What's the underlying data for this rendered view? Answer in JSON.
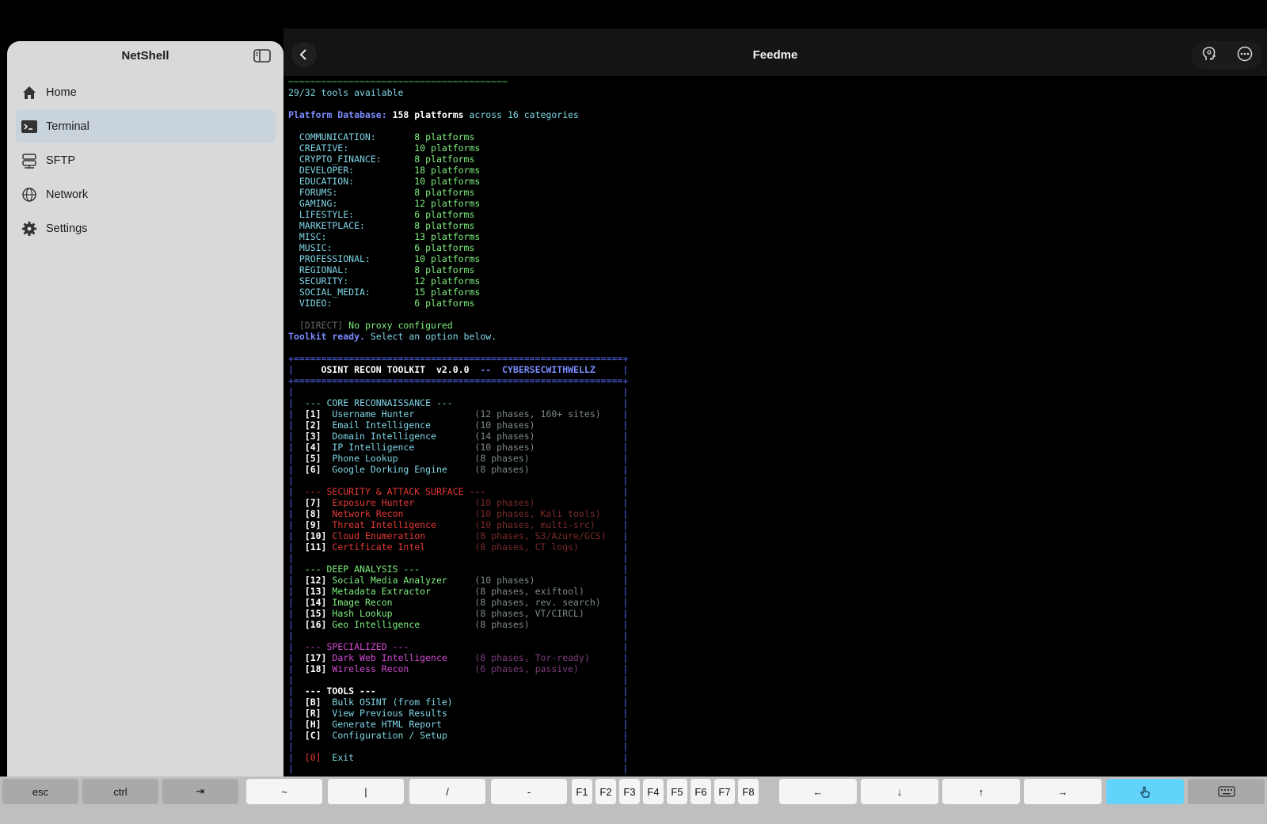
{
  "sidebar": {
    "title": "NetShell",
    "items": [
      {
        "label": "Home",
        "icon": "home-icon"
      },
      {
        "label": "Terminal",
        "icon": "terminal-icon",
        "active": true
      },
      {
        "label": "SFTP",
        "icon": "server-icon"
      },
      {
        "label": "Network",
        "icon": "globe-icon"
      },
      {
        "label": "Settings",
        "icon": "gear-icon"
      }
    ]
  },
  "header": {
    "title": "Feedme"
  },
  "terminal": {
    "tools_available": "29/32 tools available",
    "db_label": "Platform Database:",
    "db_count": "158 platforms",
    "db_mid": "across",
    "db_cat": "16 categories",
    "categories": [
      {
        "name": "COMMUNICATION:",
        "count": "8 platforms"
      },
      {
        "name": "CREATIVE:",
        "count": "10 platforms"
      },
      {
        "name": "CRYPTO_FINANCE:",
        "count": "8 platforms"
      },
      {
        "name": "DEVELOPER:",
        "count": "18 platforms"
      },
      {
        "name": "EDUCATION:",
        "count": "10 platforms"
      },
      {
        "name": "FORUMS:",
        "count": "8 platforms"
      },
      {
        "name": "GAMING:",
        "count": "12 platforms"
      },
      {
        "name": "LIFESTYLE:",
        "count": "6 platforms"
      },
      {
        "name": "MARKETPLACE:",
        "count": "8 platforms"
      },
      {
        "name": "MISC:",
        "count": "13 platforms"
      },
      {
        "name": "MUSIC:",
        "count": "6 platforms"
      },
      {
        "name": "PROFESSIONAL:",
        "count": "10 platforms"
      },
      {
        "name": "REGIONAL:",
        "count": "8 platforms"
      },
      {
        "name": "SECURITY:",
        "count": "12 platforms"
      },
      {
        "name": "SOCIAL_MEDIA:",
        "count": "15 platforms"
      },
      {
        "name": "VIDEO:",
        "count": "6 platforms"
      }
    ],
    "proxy_tag": "[DIRECT]",
    "proxy_msg": "No proxy configured",
    "ready_label": "Toolkit ready.",
    "ready_msg": "Select an option below.",
    "banner_title": "OSINT RECON TOOLKIT  v2.0.0",
    "banner_sep": "--",
    "banner_author": "CYBERSECWITHWELLZ",
    "sections": [
      {
        "title": "--- CORE RECONNAISSANCE ---",
        "style": "cyan",
        "items": [
          {
            "key": "[1]",
            "name": "Username Hunter",
            "desc": "(12 phases, 160+ sites)"
          },
          {
            "key": "[2]",
            "name": "Email Intelligence",
            "desc": "(10 phases)"
          },
          {
            "key": "[3]",
            "name": "Domain Intelligence",
            "desc": "(14 phases)"
          },
          {
            "key": "[4]",
            "name": "IP Intelligence",
            "desc": "(10 phases)"
          },
          {
            "key": "[5]",
            "name": "Phone Lookup",
            "desc": "(8 phases)"
          },
          {
            "key": "[6]",
            "name": "Google Dorking Engine",
            "desc": "(8 phases)"
          }
        ]
      },
      {
        "title": "--- SECURITY & ATTACK SURFACE ---",
        "style": "red",
        "items": [
          {
            "key": "[7]",
            "name": "Exposure Hunter",
            "desc": "(10 phases)"
          },
          {
            "key": "[8]",
            "name": "Network Recon",
            "desc": "(10 phases, Kali tools)"
          },
          {
            "key": "[9]",
            "name": "Threat Intelligence",
            "desc": "(10 phases, multi-src)"
          },
          {
            "key": "[10]",
            "name": "Cloud Enumeration",
            "desc": "(8 phases, S3/Azure/GCS)"
          },
          {
            "key": "[11]",
            "name": "Certificate Intel",
            "desc": "(8 phases, CT logs)"
          }
        ]
      },
      {
        "title": "--- DEEP ANALYSIS ---",
        "style": "green",
        "items": [
          {
            "key": "[12]",
            "name": "Social Media Analyzer",
            "desc": "(10 phases)"
          },
          {
            "key": "[13]",
            "name": "Metadata Extractor",
            "desc": "(8 phases, exiftool)"
          },
          {
            "key": "[14]",
            "name": "Image Recon",
            "desc": "(8 phases, rev. search)"
          },
          {
            "key": "[15]",
            "name": "Hash Lookup",
            "desc": "(8 phases, VT/CIRCL)"
          },
          {
            "key": "[16]",
            "name": "Geo Intelligence",
            "desc": "(8 phases)"
          }
        ]
      },
      {
        "title": "--- SPECIALIZED ---",
        "style": "magenta",
        "items": [
          {
            "key": "[17]",
            "name": "Dark Web Intelligence",
            "desc": "(8 phases, Tor-ready)"
          },
          {
            "key": "[18]",
            "name": "Wireless Recon",
            "desc": "(6 phases, passive)"
          }
        ]
      },
      {
        "title": "--- TOOLS ---",
        "style": "white",
        "items": [
          {
            "key": "[B]",
            "name": "Bulk OSINT (from file)",
            "desc": ""
          },
          {
            "key": "[R]",
            "name": "View Previous Results",
            "desc": ""
          },
          {
            "key": "[H]",
            "name": "Generate HTML Report",
            "desc": ""
          },
          {
            "key": "[C]",
            "name": "Configuration / Setup",
            "desc": ""
          }
        ]
      }
    ],
    "exit_key": "[0]",
    "exit_label": "Exit"
  },
  "keybar": {
    "keys": [
      "esc",
      "ctrl",
      "⇥",
      "~",
      "|",
      "/",
      "-",
      "F1",
      "F2",
      "F3",
      "F4",
      "F5",
      "F6",
      "F7",
      "F8",
      "←",
      "↓",
      "↑",
      "→"
    ]
  },
  "colors": {
    "accent": "#62d3fb",
    "sidebar_bg": "#d9d9d9",
    "terminal_bg": "#000000",
    "terminal_green": "#4cd964",
    "terminal_blue": "#7b8bff",
    "terminal_red": "#e53935",
    "terminal_magenta": "#d44ad4"
  }
}
